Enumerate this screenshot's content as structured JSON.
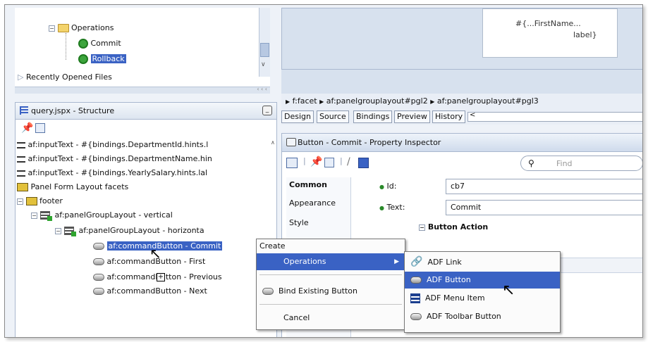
{
  "data_controls_tree": {
    "operations_folder": "Operations",
    "items": [
      "Commit",
      "Rollback"
    ],
    "recent_files": "Recently Opened Files",
    "scroll_dots": "‹ ‹ ‹"
  },
  "canvas": {
    "el_label_line1": "#{...FirstName...",
    "el_label_line2": "label}"
  },
  "breadcrumb": {
    "items": [
      "f:facet",
      "af:panelgrouplayout#pgl2",
      "af:panelgrouplayout#pgl3"
    ]
  },
  "editor_tabs": [
    "Design",
    "Source",
    "Bindings",
    "Preview",
    "History"
  ],
  "structure": {
    "title": "query.jspx - Structure",
    "rows": [
      "af:inputText - #{bindings.DepartmentId.hints.l",
      "af:inputText - #{bindings.DepartmentName.hin",
      "af:inputText - #{bindings.YearlySalary.hints.lal",
      "Panel Form Layout facets",
      "footer",
      "af:panelGroupLayout - vertical",
      "af:panelGroupLayout - horizonta",
      "af:commandButton - Commit",
      "af:commandButton - First",
      "af:commandButton - Previous",
      "af:commandButton - Next"
    ]
  },
  "property_inspector": {
    "title": "Button - Commit - Property Inspector",
    "find_placeholder": "Find",
    "categories": [
      "Common",
      "Appearance",
      "Style"
    ],
    "id_label": "Id:",
    "id_value": "cb7",
    "text_label": "Text:",
    "text_value": "Commit",
    "button_action": "Button Action"
  },
  "context_menu": {
    "header": "Create",
    "items": [
      "Operations",
      "Bind Existing Button",
      "Cancel"
    ]
  },
  "submenu": {
    "items": [
      "ADF Link",
      "ADF Button",
      "ADF Menu Item",
      "ADF Toolbar Button"
    ]
  },
  "colors": {
    "selection": "#3a62c4",
    "panel_border": "#a9b8cf"
  }
}
